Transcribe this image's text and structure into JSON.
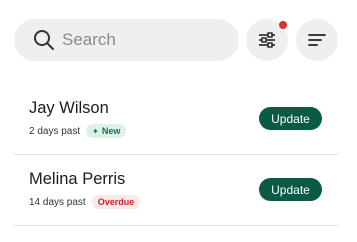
{
  "colors": {
    "accent": "#0b5a45",
    "notification_dot": "#d9332b",
    "new_badge_bg": "#ddf2e7",
    "new_badge_text": "#1e6e47",
    "overdue_badge_bg": "#fde8e8",
    "overdue_badge_text": "#c62828",
    "surface": "#efefef"
  },
  "search": {
    "placeholder": "Search",
    "value": "",
    "icon": "search-icon"
  },
  "toolbar": {
    "filter_icon": "sliders-icon",
    "filter_has_notification": true,
    "sort_icon": "sort-lines-icon"
  },
  "items": [
    {
      "name": "Jay Wilson",
      "time": "2 days past",
      "badge": "New",
      "badge_type": "new",
      "badge_icon": "sparkle-icon",
      "action": "Update"
    },
    {
      "name": "Melina Perris",
      "time": "14 days past",
      "badge": "Overdue",
      "badge_type": "overdue",
      "action": "Update"
    }
  ]
}
